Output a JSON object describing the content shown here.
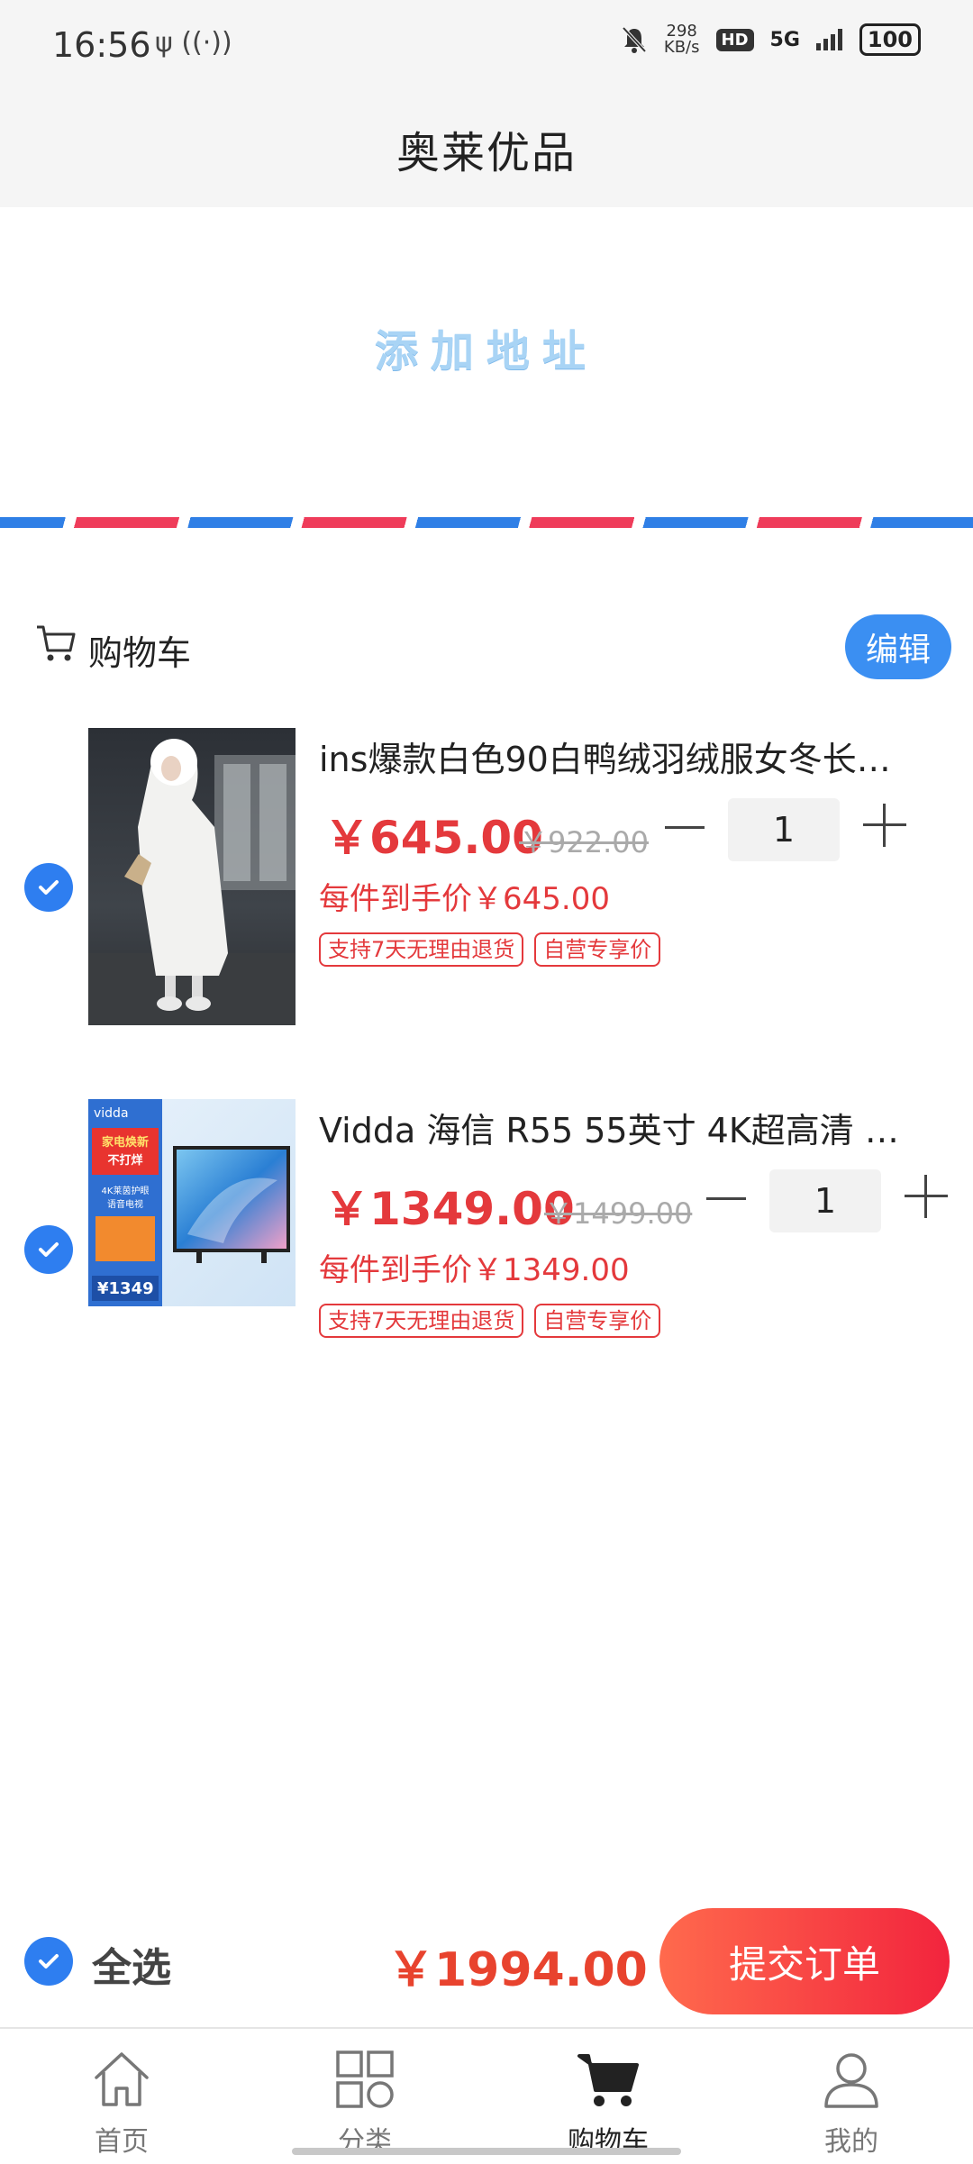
{
  "status": {
    "time": "16:56",
    "left_icons": "ψ ((·))",
    "speed_value": "298",
    "speed_unit": "KB/s",
    "hd": "HD",
    "network": "5G",
    "battery": "100"
  },
  "header": {
    "title": "奥莱优品"
  },
  "address": {
    "add_label": "添加地址"
  },
  "cart": {
    "label": "购物车",
    "edit_label": "编辑",
    "items": [
      {
        "name": "ins爆款白色90白鸭绒羽绒服女冬长…",
        "price": "￥645.00",
        "original_price": "￥922.00",
        "quantity": "1",
        "final_price": "每件到手价￥645.00",
        "tags": [
          "支持7天无理由退货",
          "自营专享价"
        ],
        "selected": true
      },
      {
        "name": "Vidda 海信 R55 55英寸 4K超高清 …",
        "price": "￥1349.00",
        "original_price": "￥1499.00",
        "quantity": "1",
        "final_price": "每件到手价￥1349.00",
        "tags": [
          "支持7天无理由退货",
          "自营专享价"
        ],
        "selected": true,
        "thumb_text": {
          "brand": "vidda",
          "promo1": "家电焕新",
          "promo2": "不打烊",
          "feature1": "4K莱茵护眼",
          "feature2": "语音电视",
          "price": "¥1349"
        }
      }
    ]
  },
  "footer": {
    "select_all": "全选",
    "total": "￥1994.00",
    "submit": "提交订单"
  },
  "tabs": [
    {
      "label": "首页",
      "icon": "home-icon",
      "active": false
    },
    {
      "label": "分类",
      "icon": "category-icon",
      "active": false
    },
    {
      "label": "购物车",
      "icon": "cart-icon",
      "active": true
    },
    {
      "label": "我的",
      "icon": "user-icon",
      "active": false
    }
  ],
  "colors": {
    "accent_blue": "#2e7ef0",
    "price_red": "#e4393c",
    "submit_gradient_start": "#ff6a4d",
    "submit_gradient_end": "#f2243d"
  }
}
